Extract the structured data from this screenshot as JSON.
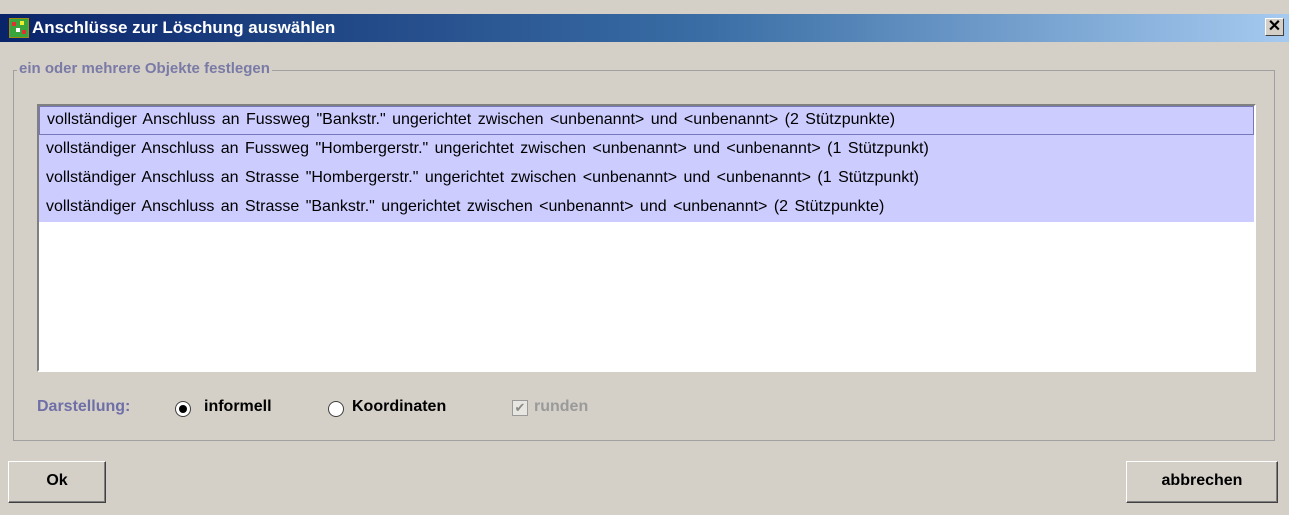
{
  "window": {
    "title": "Anschlüsse zur Löschung auswählen",
    "close_label": "✕"
  },
  "group": {
    "legend": "ein oder mehrere Objekte festlegen"
  },
  "list": {
    "items": [
      "vollständiger Anschluss an  Fussweg \"Bankstr.\"  ungerichtet  zwischen <unbenannt> und <unbenannt>  (2 Stützpunkte)",
      "vollständiger Anschluss an  Fussweg \"Hombergerstr.\"  ungerichtet  zwischen <unbenannt> und <unbenannt>  (1 Stützpunkt)",
      "vollständiger Anschluss an  Strasse  \"Hombergerstr.\"  ungerichtet  zwischen <unbenannt> und <unbenannt>  (1 Stützpunkt)",
      "vollständiger Anschluss an  Strasse  \"Bankstr.\"  ungerichtet  zwischen <unbenannt> und <unbenannt>  (2 Stützpunkte)"
    ],
    "selected": [
      0,
      1,
      2,
      3
    ]
  },
  "options": {
    "label": "Darstellung:",
    "radio_informell": "informell",
    "radio_koordinaten": "Koordinaten",
    "selected": "informell",
    "checkbox_runden": "runden",
    "runden_checked": true,
    "runden_enabled": false
  },
  "buttons": {
    "ok": "Ok",
    "cancel": "abbrechen"
  },
  "colors": {
    "title_gradient_start": "#0a246a",
    "title_gradient_end": "#a6caf0",
    "selection": "#ccccff",
    "dialog_bg": "#d4d0c8",
    "label_color": "#6f6fa8"
  }
}
